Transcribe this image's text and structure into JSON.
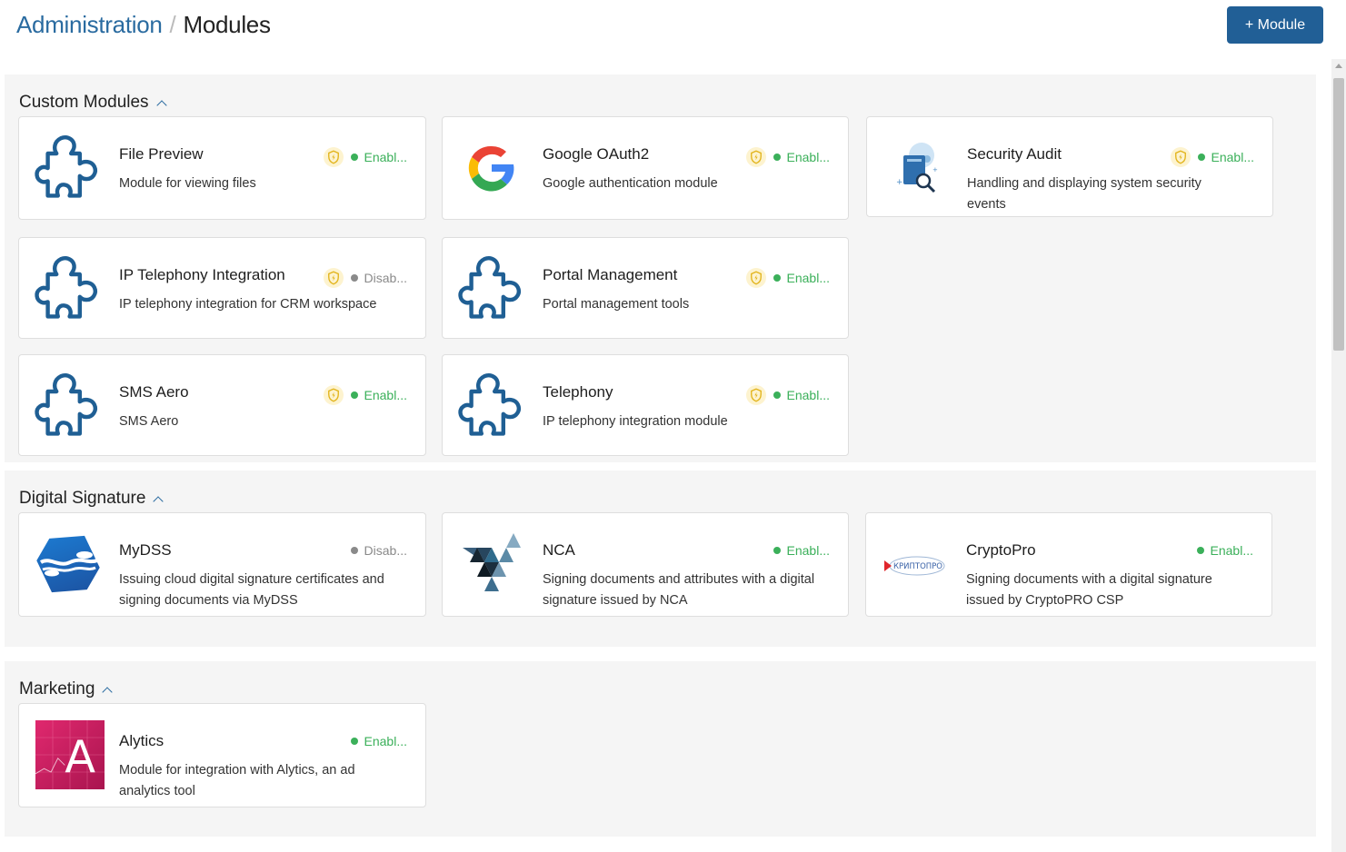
{
  "header": {
    "breadcrumb_parent": "Administration",
    "breadcrumb_separator": "/",
    "breadcrumb_current": "Modules",
    "add_button_label": "+ Module"
  },
  "colors": {
    "accent": "#215f96",
    "enabled": "#3bb05a",
    "disabled": "#8a8a8a",
    "puzzle": "#1f5f94"
  },
  "sections": [
    {
      "title": "Custom Modules",
      "modules": [
        {
          "name": "File Preview",
          "description": "Module for viewing files",
          "status": "Enabl...",
          "icon": "puzzle-icon",
          "shield": true
        },
        {
          "name": "Google OAuth2",
          "description": "Google authentication module",
          "status": "Enabl...",
          "icon": "google-icon",
          "shield": true
        },
        {
          "name": "Security Audit",
          "description": "Handling and displaying system security events",
          "status": "Enabl...",
          "icon": "security-audit-icon",
          "shield": true
        },
        {
          "name": "IP Telephony Integration",
          "description": "IP telephony integration for CRM workspace",
          "status": "Disab...",
          "icon": "puzzle-icon",
          "shield": true
        },
        {
          "name": "Portal Management",
          "description": "Portal management tools",
          "status": "Enabl...",
          "icon": "puzzle-icon",
          "shield": true
        },
        {
          "name": "SMS Aero",
          "description": "SMS Aero",
          "status": "Enabl...",
          "icon": "puzzle-icon",
          "shield": true
        },
        {
          "name": "Telephony",
          "description": "IP telephony integration module",
          "status": "Enabl...",
          "icon": "puzzle-icon",
          "shield": true
        }
      ]
    },
    {
      "title": "Digital Signature",
      "modules": [
        {
          "name": "MyDSS",
          "description": "Issuing cloud digital signature certificates and signing documents via MyDSS",
          "status": "Disab...",
          "icon": "mydss-logo",
          "shield": false
        },
        {
          "name": "NCA",
          "description": "Signing documents and attributes with a digital signature issued by NCA",
          "status": "Enabl...",
          "icon": "nca-logo",
          "shield": false
        },
        {
          "name": "CryptoPro",
          "description": "Signing documents with a digital signature issued by CryptoPRO CSP",
          "status": "Enabl...",
          "icon": "cryptopro-logo",
          "shield": false,
          "logo_text": "КРИПТОПРО"
        }
      ]
    },
    {
      "title": "Marketing",
      "modules": [
        {
          "name": "Alytics",
          "description": "Module for integration with Alytics, an ad analytics tool",
          "status": "Enabl...",
          "icon": "alytics-logo",
          "shield": false,
          "logo_text": "A"
        }
      ]
    }
  ]
}
